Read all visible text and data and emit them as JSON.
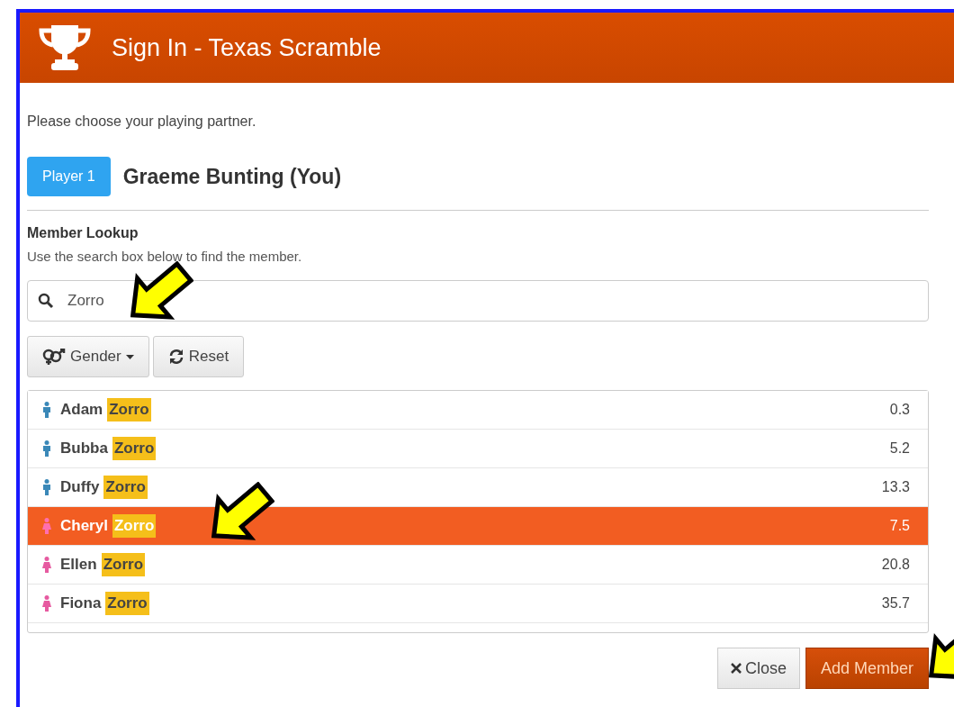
{
  "header": {
    "title": "Sign In - Texas Scramble"
  },
  "prompt": "Please choose your playing partner.",
  "player": {
    "badge": "Player 1",
    "name": "Graeme Bunting (You)"
  },
  "lookup": {
    "heading": "Member Lookup",
    "help": "Use the search box below to find the member.",
    "search_value": "Zorro"
  },
  "filters": [
    {
      "kind": "gender",
      "label": "Gender"
    },
    {
      "kind": "reset",
      "label": "Reset"
    }
  ],
  "members": [
    {
      "first": "Adam",
      "match": "Zorro",
      "handicap": "0.3",
      "kind": "male",
      "selected": false
    },
    {
      "first": "Bubba",
      "match": "Zorro",
      "handicap": "5.2",
      "kind": "male",
      "selected": false
    },
    {
      "first": "Duffy",
      "match": "Zorro",
      "handicap": "13.3",
      "kind": "male",
      "selected": false
    },
    {
      "first": "Cheryl",
      "match": "Zorro",
      "handicap": "7.5",
      "kind": "female",
      "selected": true
    },
    {
      "first": "Ellen",
      "match": "Zorro",
      "handicap": "20.8",
      "kind": "female",
      "selected": false
    },
    {
      "first": "Fiona",
      "match": "Zorro",
      "handicap": "35.7",
      "kind": "female",
      "selected": false
    }
  ],
  "footer": {
    "close": "Close",
    "add": "Add Member"
  }
}
